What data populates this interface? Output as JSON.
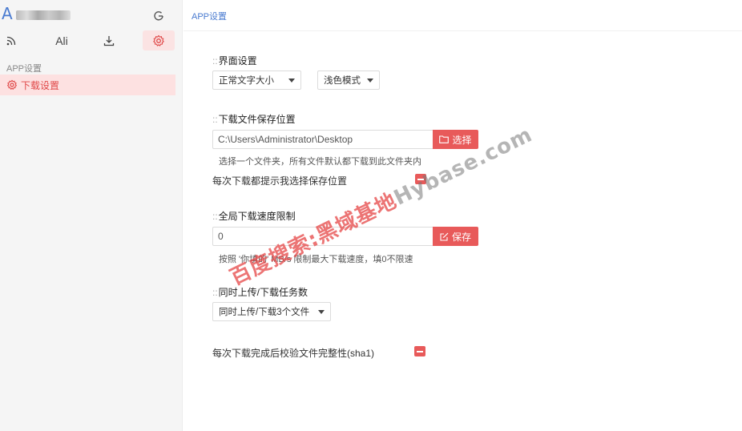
{
  "sidebar": {
    "brand_letter": "A",
    "toolbar": {
      "ali_label": "Ali"
    },
    "section_label": "APP设置",
    "active_item_label": "下载设置"
  },
  "main": {
    "breadcrumb": "APP设置",
    "interface": {
      "title_dots": "::",
      "title": "界面设置",
      "font_size_value": "正常文字大小",
      "theme_value": "浅色模式"
    },
    "download_location": {
      "title_dots": "::",
      "title": "下载文件保存位置",
      "path_value": "C:\\Users\\Administrator\\Desktop",
      "choose_label": "选择",
      "hint": "选择一个文件夹，所有文件默认都下载到此文件夹内",
      "prompt_toggle_label": "每次下载都提示我选择保存位置"
    },
    "speed_limit": {
      "title_dots": "::",
      "title": "全局下载速度限制",
      "value": "0",
      "save_label": "保存",
      "hint": "按照 '你填的' MB/s 限制最大下载速度，填0不限速"
    },
    "tasks": {
      "title_dots": "::",
      "title": "同时上传/下载任务数",
      "value": "同时上传/下载3个文件"
    },
    "verify_toggle_label": "每次下载完成后校验文件完整性(sha1)"
  },
  "watermark": {
    "red_text": "百度搜索:黑域基地",
    "gray_text": "Hybase.com"
  },
  "colors": {
    "accent": "#e85a5a",
    "link": "#4a7bd0",
    "active_bg": "#fde1e1"
  }
}
